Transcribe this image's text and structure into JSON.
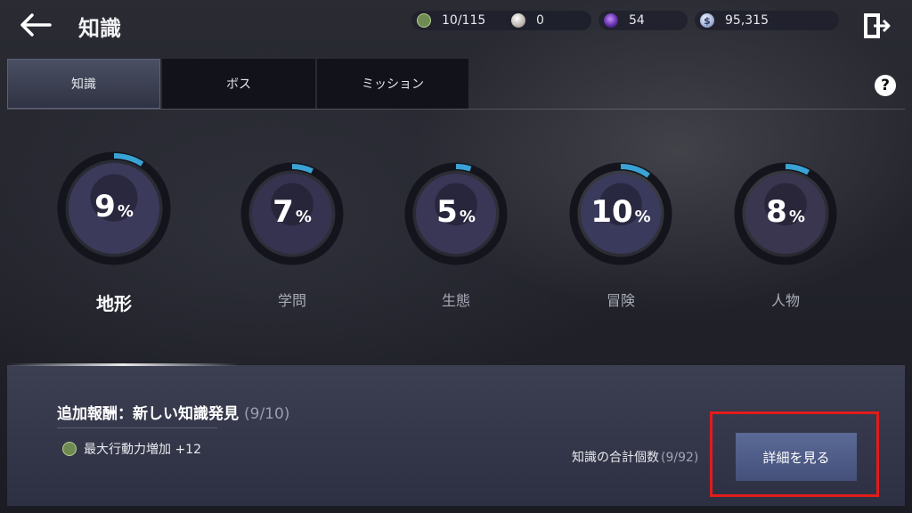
{
  "header": {
    "title": "知識",
    "resources": [
      {
        "name": "energy",
        "icon": "energy-icon",
        "value": "10/115"
      },
      {
        "name": "pearl",
        "icon": "pearl-icon",
        "value": "0"
      },
      {
        "name": "crystal",
        "icon": "crystal-icon",
        "value": "54"
      },
      {
        "name": "silver",
        "icon": "silver-coin-icon",
        "icon_glyph": "$",
        "value": "95,315"
      }
    ]
  },
  "tabs": [
    {
      "label": "知識",
      "active": true
    },
    {
      "label": "ボス",
      "active": false
    },
    {
      "label": "ミッション",
      "active": false
    }
  ],
  "help_label": "?",
  "categories": [
    {
      "label": "地形",
      "percent": "9",
      "unit": "%",
      "progress": 0.09,
      "active": true
    },
    {
      "label": "学問",
      "percent": "7",
      "unit": "%",
      "progress": 0.07,
      "active": false
    },
    {
      "label": "生態",
      "percent": "5",
      "unit": "%",
      "progress": 0.05,
      "active": false
    },
    {
      "label": "冒険",
      "percent": "10",
      "unit": "%",
      "progress": 0.1,
      "active": false
    },
    {
      "label": "人物",
      "percent": "8",
      "unit": "%",
      "progress": 0.08,
      "active": false
    }
  ],
  "reward": {
    "title": "追加報酬：新しい知識発見",
    "progress": "(9/10)",
    "item_label": "最大行動力増加 +12"
  },
  "total": {
    "label": "知識の合計個数",
    "value": "(9/92)"
  },
  "detail_button": "詳細を見る",
  "colors": {
    "progress_arc": "#3aa3d6",
    "highlight": "#e11c1c",
    "button": "#4f5c88"
  }
}
